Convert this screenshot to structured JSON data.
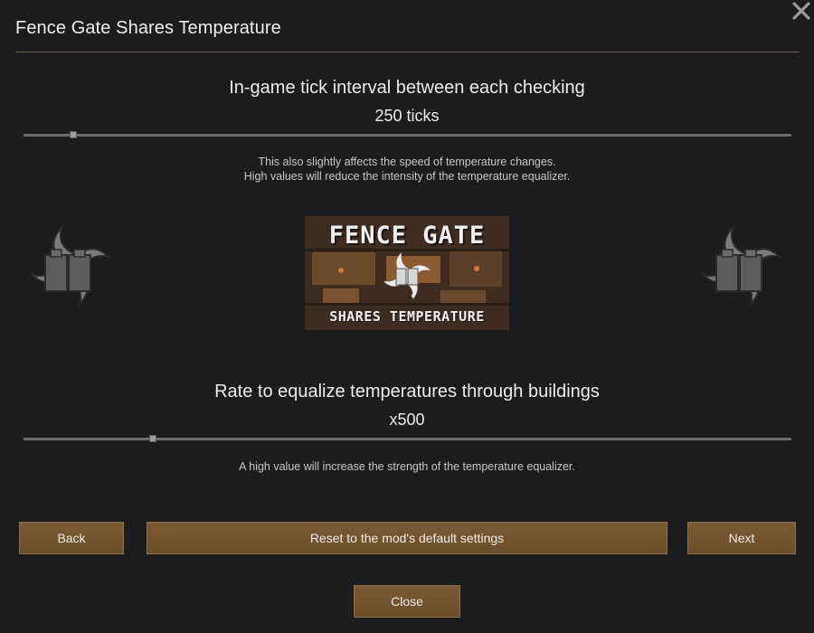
{
  "window": {
    "title": "Fence Gate Shares Temperature"
  },
  "tick_setting": {
    "heading": "In-game tick interval between each checking",
    "value_text": "250 ticks",
    "slider_fraction": 0.065,
    "note_line1": "This also slightly affects the speed of temperature changes.",
    "note_line2": "High values will reduce the intensity of the temperature equalizer."
  },
  "logo": {
    "title": "FENCE GATE",
    "subtitle": "SHARES TEMPERATURE"
  },
  "rate_setting": {
    "heading": "Rate to equalize temperatures through buildings",
    "value_text": "x500",
    "slider_fraction": 0.168,
    "note": "A high value will increase the strength of the temperature equalizer."
  },
  "buttons": {
    "back": "Back",
    "reset": "Reset to the mod's default settings",
    "next": "Next",
    "close": "Close"
  },
  "icons": {
    "close": "close-icon",
    "left": "fence-gate-temperature-icon",
    "right": "fence-gate-temperature-icon"
  },
  "colors": {
    "background": "#1b1c1e",
    "button": "#75552e",
    "rule": "#7a6040"
  }
}
